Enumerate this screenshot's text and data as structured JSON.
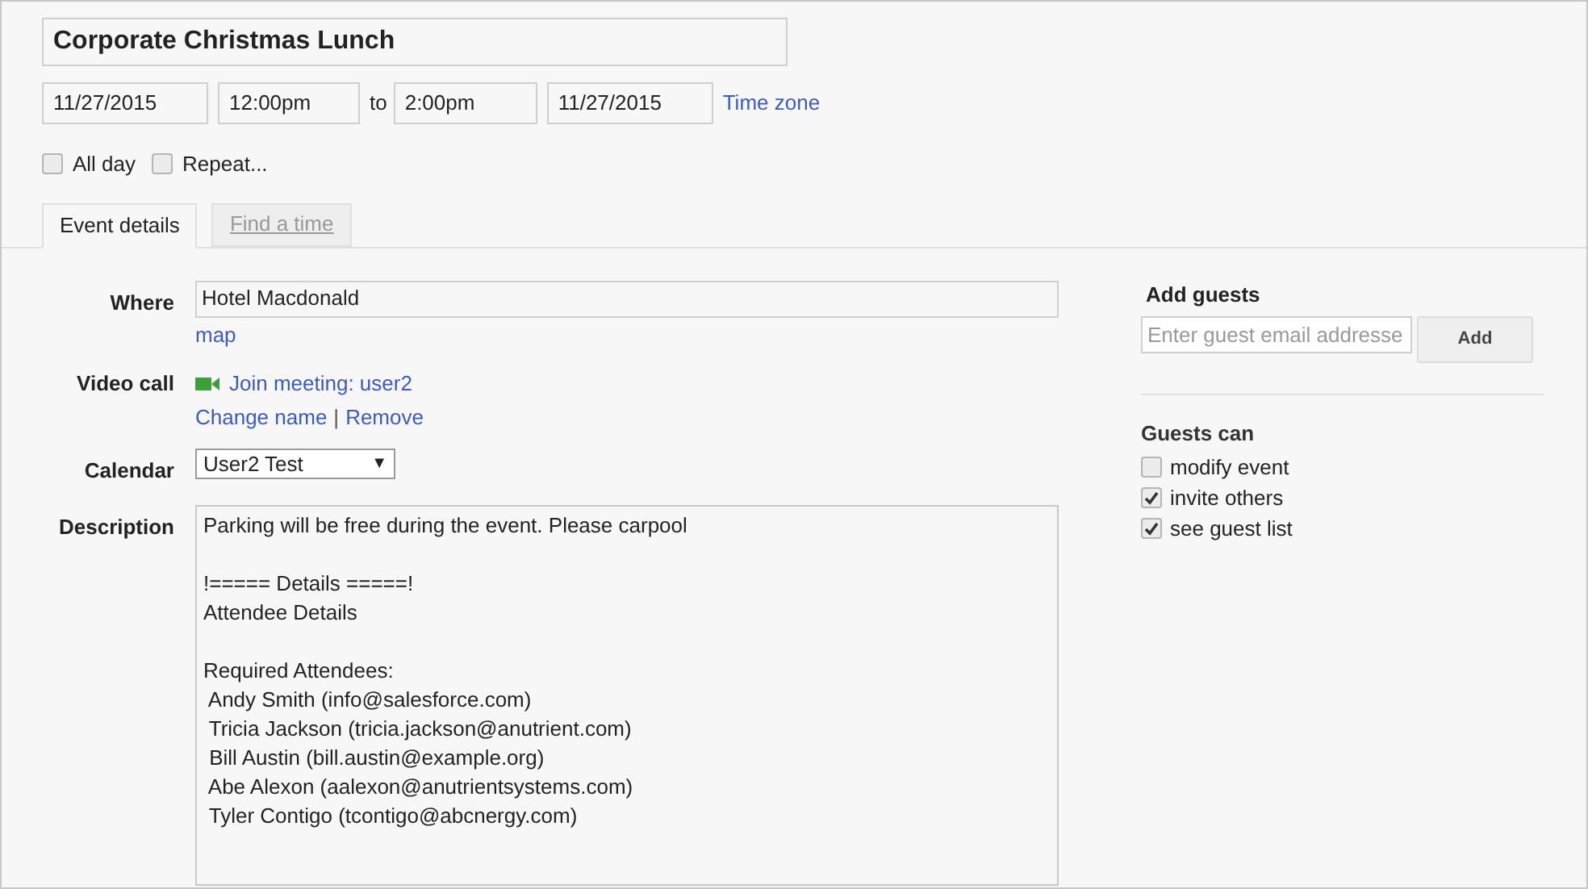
{
  "title": "Corporate Christmas Lunch",
  "when": {
    "start_date": "11/27/2015",
    "start_time": "12:00pm",
    "separator": "to",
    "end_time": "2:00pm",
    "end_date": "11/27/2015",
    "time_zone_link": "Time zone"
  },
  "options": [
    {
      "label": "All day",
      "checked": false
    },
    {
      "label": "Repeat...",
      "checked": false
    }
  ],
  "tabs": [
    {
      "label": "Event details",
      "selected": true
    },
    {
      "label": "Find a time",
      "selected": false
    }
  ],
  "where": {
    "label": "Where",
    "value": "Hotel Macdonald",
    "link": "map"
  },
  "video_call": {
    "label": "Video call",
    "join_link": "Join meeting: user2",
    "change_link": "Change name",
    "separator": "|",
    "remove_link": "Remove"
  },
  "calendar": {
    "label": "Calendar",
    "value": "User2 Test",
    "caret": "▼"
  },
  "description": {
    "label": "Description",
    "paragraphs": [
      [
        "Parking will be free during the event. Please carpool"
      ],
      [
        "!===== Details =====!",
        "Attendee Details"
      ],
      [
        "Required Attendees:",
        " Andy Smith (info@salesforce.com)",
        " Tricia Jackson (tricia.jackson@anutrient.com)",
        " Bill Austin (bill.austin@example.org)",
        " Abe Alexon (aalexon@anutrientsystems.com)",
        " Tyler Contigo (tcontigo@abcnergy.com)"
      ]
    ]
  },
  "add_guests": {
    "title": "Add guests",
    "placeholder": "Enter guest email addresse",
    "button": "Add"
  },
  "guests_can": {
    "title": "Guests can",
    "items": [
      {
        "label": "modify event",
        "checked": false
      },
      {
        "label": "invite others",
        "checked": true
      },
      {
        "label": "see guest list",
        "checked": true
      }
    ]
  }
}
